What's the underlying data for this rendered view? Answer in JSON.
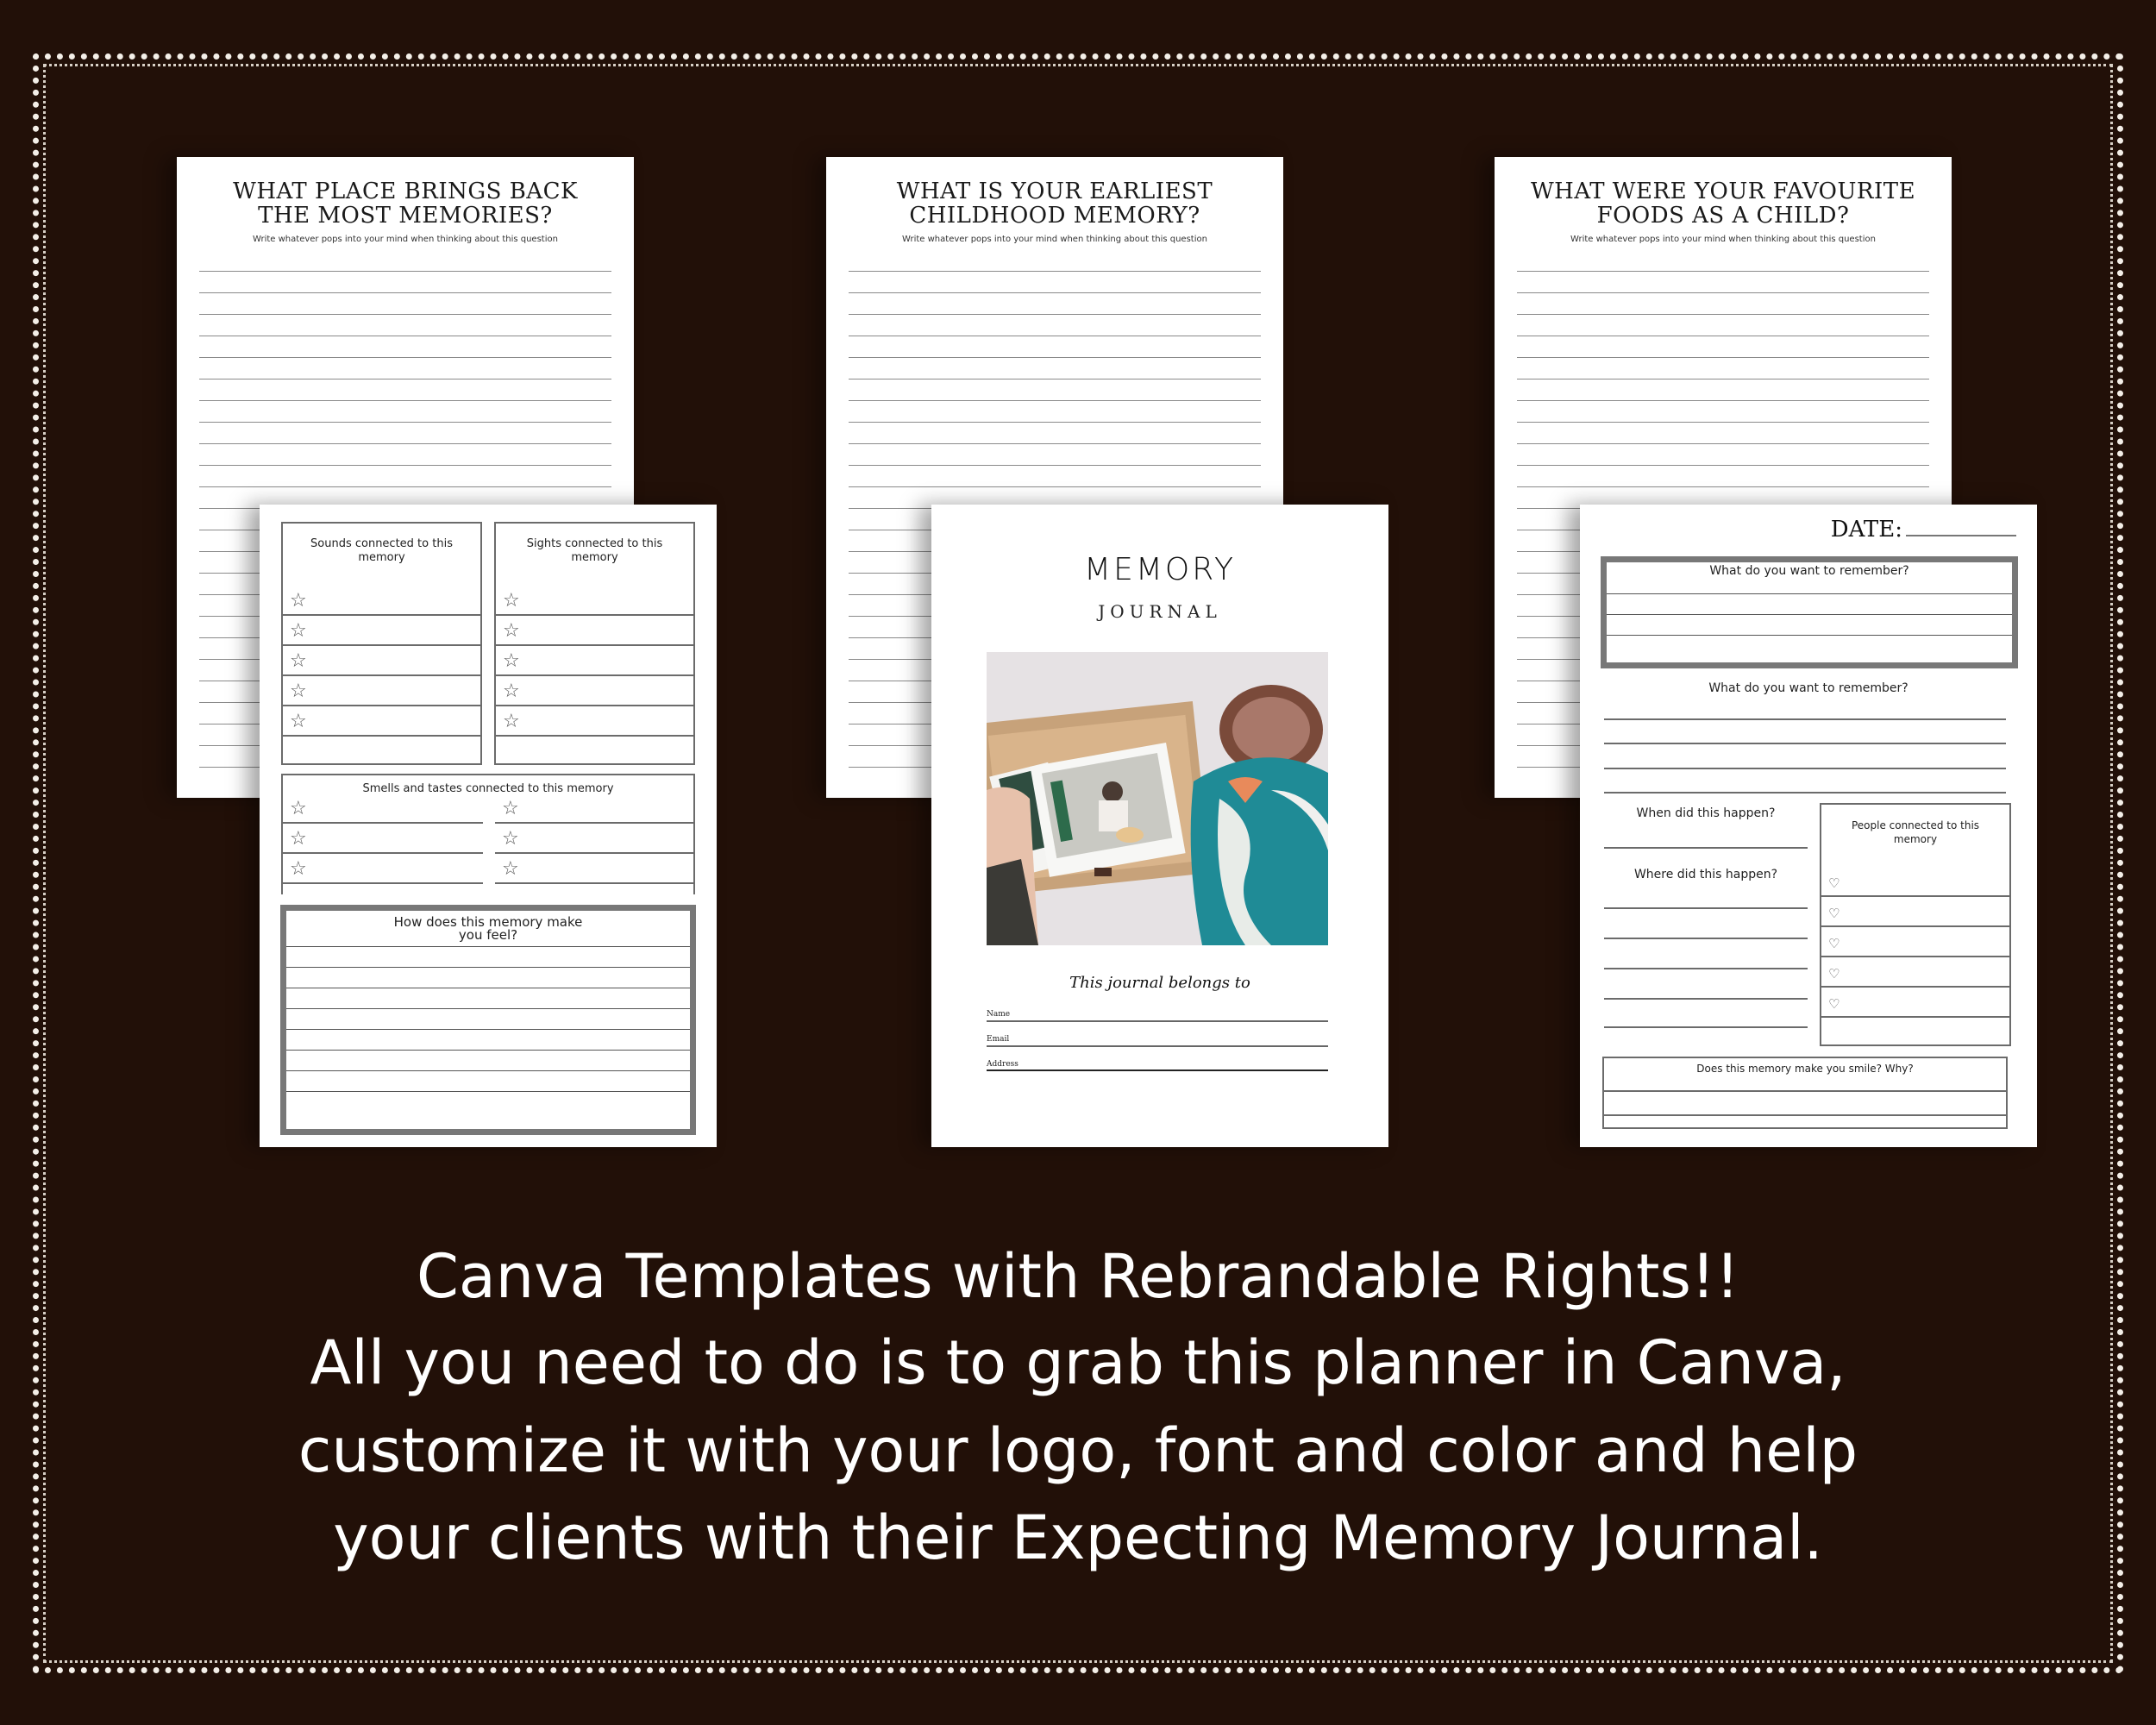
{
  "background_color": "#221008",
  "pages": {
    "prompt_1": {
      "title_line1": "WHAT PLACE BRINGS BACK",
      "title_line2": "THE MOST MEMORIES?",
      "subtitle": "Write whatever pops into your mind when thinking about this question"
    },
    "prompt_2": {
      "title_line1": "WHAT IS YOUR EARLIEST",
      "title_line2": "CHILDHOOD MEMORY?",
      "subtitle": "Write whatever pops into your mind when thinking about this question"
    },
    "prompt_3": {
      "title_line1": "WHAT WERE YOUR FAVOURITE",
      "title_line2": "FOODS AS A CHILD?",
      "subtitle": "Write whatever pops into your mind when thinking about this question"
    },
    "senses": {
      "sounds_line1": "Sounds connected to this",
      "sounds_line2": "memory",
      "sights_line1": "Sights connected to this",
      "sights_line2": "memory",
      "smells": "Smells and tastes connected to this memory",
      "feel_line1": "How does this memory make",
      "feel_line2": "you feel?",
      "star_icon": "☆"
    },
    "cover": {
      "title": "MEMORY",
      "subtitle": "JOURNAL",
      "photo_alt": "hands holding instant photos in a wooden box",
      "belongs_to": "This journal belongs to",
      "fields": [
        "Name",
        "Email",
        "Address"
      ]
    },
    "reflection": {
      "date_label": "DATE:",
      "q1": "What do you want to remember?",
      "q2": "What do you want to remember?",
      "when": "When did this happen?",
      "where": "Where did this happen?",
      "people_line1": "People connected to this",
      "people_line2": "memory",
      "smile": "Does this memory make you smile? Why?",
      "heart_icon": "♡"
    }
  },
  "promo": {
    "line1": "Canva Templates with Rebrandable Rights!!",
    "line2": "All you need to do is to grab this planner in Canva,",
    "line3": "customize it with your logo, font and color and help",
    "line4": "your clients with their Expecting Memory Journal."
  }
}
